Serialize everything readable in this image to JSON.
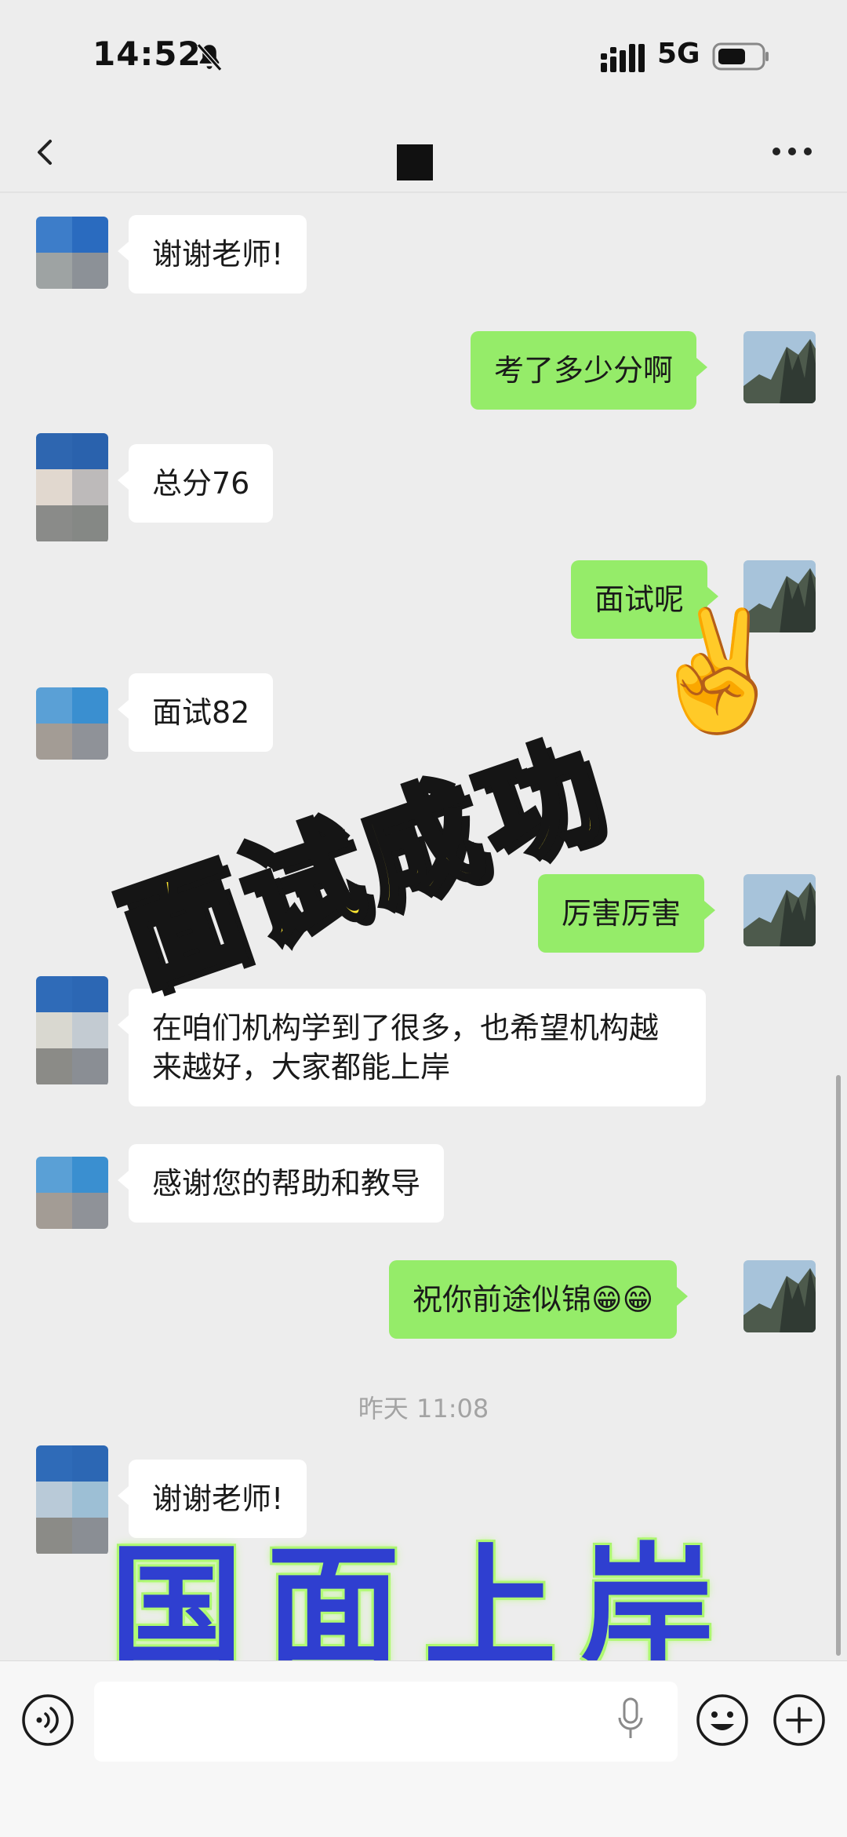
{
  "status": {
    "time": "14:52",
    "network": "5G"
  },
  "nav": {
    "title": ""
  },
  "messages": [
    {
      "side": "in",
      "text": "谢谢老师!"
    },
    {
      "side": "out",
      "text": "考了多少分啊"
    },
    {
      "side": "in",
      "text": "总分76"
    },
    {
      "side": "out",
      "text": "面试呢"
    },
    {
      "side": "in",
      "text": "面试82"
    },
    {
      "side": "out",
      "text": "厉害厉害"
    },
    {
      "side": "in",
      "text": "在咱们机构学到了很多，也希望机构越来越好，大家都能上岸"
    },
    {
      "side": "in",
      "text": "感谢您的帮助和教导"
    },
    {
      "side": "out",
      "text": "祝你前途似锦😁😁"
    },
    {
      "side": "in",
      "text": "谢谢老师!"
    }
  ],
  "timestamp": "昨天 11:08",
  "overlays": {
    "sticker_top": "面试成功",
    "sticker_emoji": "✌️",
    "sticker_bottom": "国面上岸"
  },
  "input": {
    "placeholder": ""
  },
  "colors": {
    "outgoing_bubble": "#95ec69",
    "incoming_bubble": "#ffffff",
    "background": "#ededed",
    "sticker_yellow": "#ffe832",
    "sticker_blue": "#2f3fd0"
  },
  "icons": [
    "chevron-left-icon",
    "more-icon",
    "bell-off-icon",
    "signal-icon",
    "battery-icon",
    "voice-icon",
    "mic-icon",
    "emoji-icon",
    "plus-icon"
  ]
}
